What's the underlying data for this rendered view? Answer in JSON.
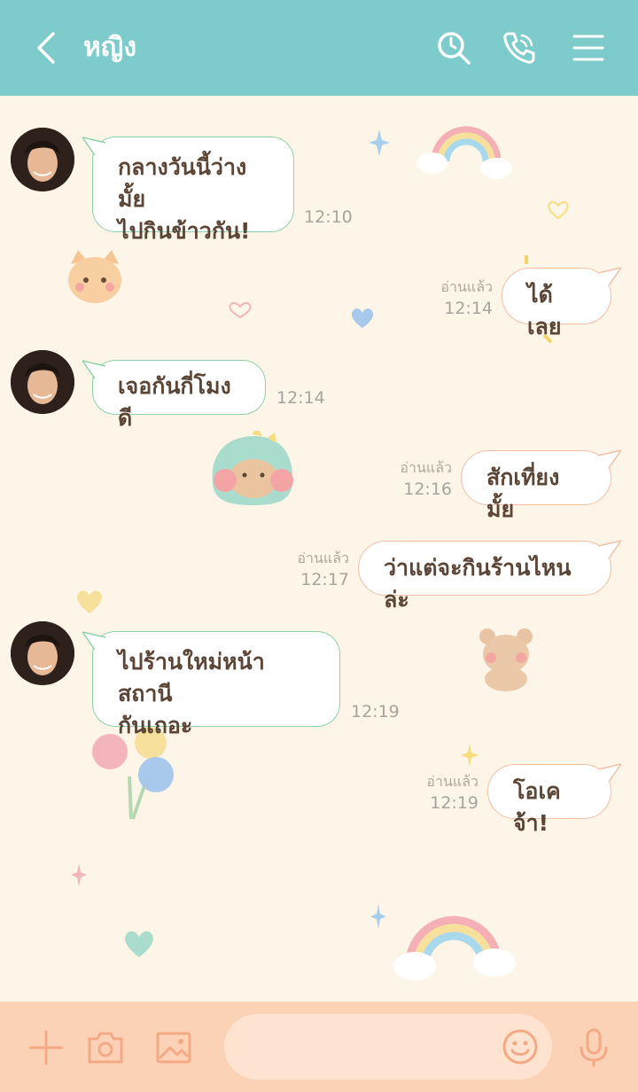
{
  "header": {
    "title": "หญิง",
    "icons": [
      "back-chevron-icon",
      "search-icon",
      "phone-icon",
      "menu-icon"
    ]
  },
  "messages": [
    {
      "side": "in",
      "lines": [
        "กลางวันนี้ว่างมั้ย",
        "ไปกินข้าวกัน!"
      ],
      "time": "12:10"
    },
    {
      "side": "out",
      "text": "ได้เลย",
      "read": "อ่านแล้ว",
      "time": "12:14"
    },
    {
      "side": "in",
      "text": "เจอกันกี่โมงดี",
      "time": "12:14"
    },
    {
      "side": "out",
      "text": "สักเที่ยงมั้ย",
      "read": "อ่านแล้ว",
      "time": "12:16"
    },
    {
      "side": "out",
      "text": "ว่าแต่จะกินร้านไหนล่ะ",
      "read": "อ่านแล้ว",
      "time": "12:17"
    },
    {
      "side": "in",
      "lines": [
        "ไปร้านใหม่หน้าสถานี",
        "กันเถอะ"
      ],
      "time": "12:19"
    },
    {
      "side": "out",
      "text": "โอเคจ้า!",
      "read": "อ่านแล้ว",
      "time": "12:19"
    }
  ],
  "footer": {
    "message_input_placeholder": "",
    "icons": [
      "plus-icon",
      "camera-icon",
      "image-icon",
      "emoji-icon",
      "microphone-icon"
    ]
  },
  "colors": {
    "header_bg": "#7ecbcb",
    "chat_bg": "#fdf6e8",
    "footer_bg": "#fcd2b6",
    "incoming_border": "#8fd0a8",
    "outgoing_border": "#f1bfa5",
    "text": "#5b4536"
  }
}
